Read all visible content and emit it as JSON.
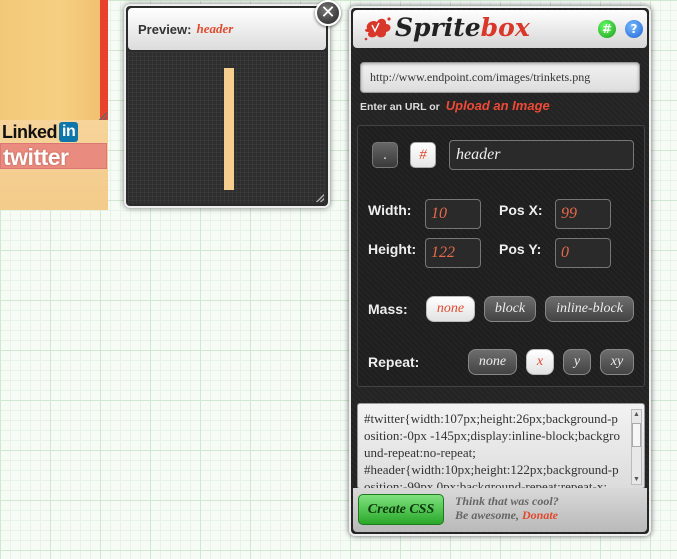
{
  "sprite_sheet": {
    "linkedin_text": "Linked",
    "linkedin_in": "in",
    "twitter_text": "twitter"
  },
  "preview": {
    "label": "Preview:",
    "selector_name": "header",
    "close_glyph": "✕"
  },
  "spritebox": {
    "logo_part1": "Sprite",
    "logo_part2": "box",
    "grid_icon_glyph": "#",
    "help_icon_glyph": "?",
    "url_value": "http://www.endpoint.com/images/trinkets.png",
    "url_hint": "Enter an URL or",
    "upload_label": "Upload an Image",
    "selector_class_btn": ".",
    "selector_id_btn": "#",
    "selector_name": "header",
    "width_label": "Width:",
    "width_value": "10",
    "height_label": "Height:",
    "height_value": "122",
    "posx_label": "Pos X:",
    "posx_value": "99",
    "posy_label": "Pos Y:",
    "posy_value": "0",
    "mass_label": "Mass:",
    "mass_options": [
      "none",
      "block",
      "inline-block"
    ],
    "mass_selected": "none",
    "repeat_label": "Repeat:",
    "repeat_options": [
      "none",
      "x",
      "y",
      "xy"
    ],
    "repeat_selected": "x",
    "css_output": "#twitter{width:107px;height:26px;background-position:-0px -145px;display:inline-block;background-repeat:no-repeat;\n#header{width:10px;height:122px;background-position:-99px 0px;background-repeat:repeat-x;",
    "create_css_label": "Create CSS",
    "promo_line1": "Think that was cool?",
    "promo_line2": "Be awesome,",
    "donate_label": "Donate"
  },
  "colors": {
    "accent": "#e04a2e",
    "panel_bg": "#232323",
    "create_button": "#2aa82a"
  }
}
